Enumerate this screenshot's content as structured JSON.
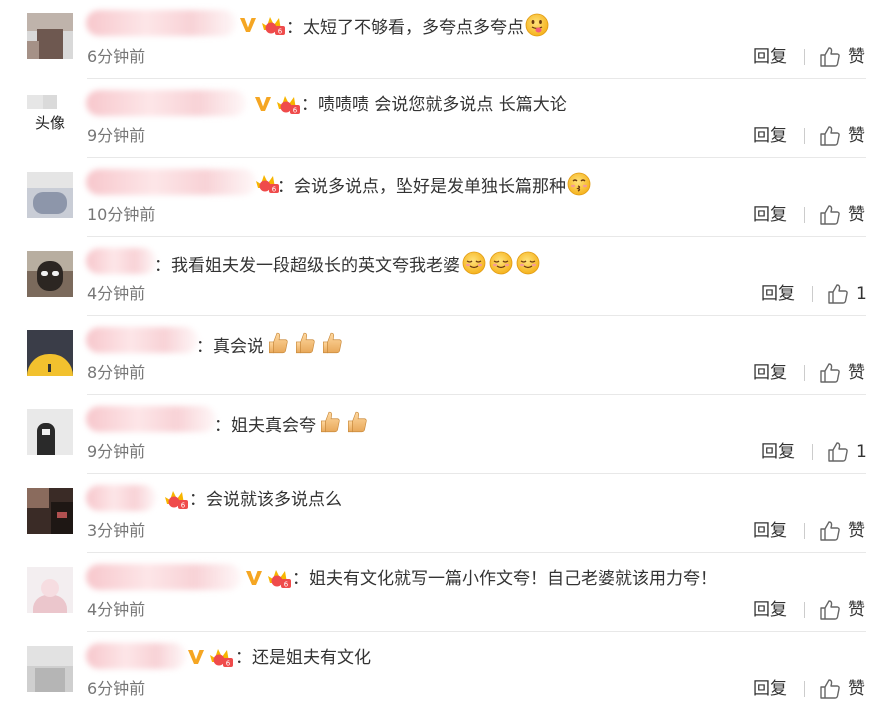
{
  "comments": [
    {
      "text": "太短了不够看，多夸点多夸点",
      "time": "6分钟前",
      "reply": "回复",
      "like": "赞",
      "emojis": [
        "tongue"
      ]
    },
    {
      "text": "啧啧啧 会说您就多说点 长篇大论",
      "time": "9分钟前",
      "reply": "回复",
      "like": "赞",
      "avatar_text": "头像",
      "emojis": []
    },
    {
      "text": "会说多说点，坠好是发单独长篇那种",
      "time": "10分钟前",
      "reply": "回复",
      "like": "赞",
      "emojis": [
        "kiss"
      ]
    },
    {
      "text": "我看姐夫发一段超级长的英文夸我老婆",
      "time": "4分钟前",
      "reply": "回复",
      "like": "1",
      "emojis": [
        "sly",
        "sly",
        "sly"
      ]
    },
    {
      "text": "真会说",
      "time": "8分钟前",
      "reply": "回复",
      "like": "赞",
      "emojis": [
        "thumb",
        "thumb",
        "thumb"
      ]
    },
    {
      "text": "姐夫真会夸",
      "time": "9分钟前",
      "reply": "回复",
      "like": "1",
      "emojis": [
        "thumb",
        "thumb"
      ]
    },
    {
      "text": "会说就该多说点么",
      "time": "3分钟前",
      "reply": "回复",
      "like": "赞",
      "emojis": []
    },
    {
      "text": "姐夫有文化就写一篇小作文夸！自己老婆就该用力夸！",
      "time": "4分钟前",
      "reply": "回复",
      "like": "赞",
      "emojis": []
    },
    {
      "text": "还是姐夫有文化",
      "time": "6分钟前",
      "reply": "回复",
      "like": "赞",
      "emojis": []
    }
  ],
  "separator": "|"
}
